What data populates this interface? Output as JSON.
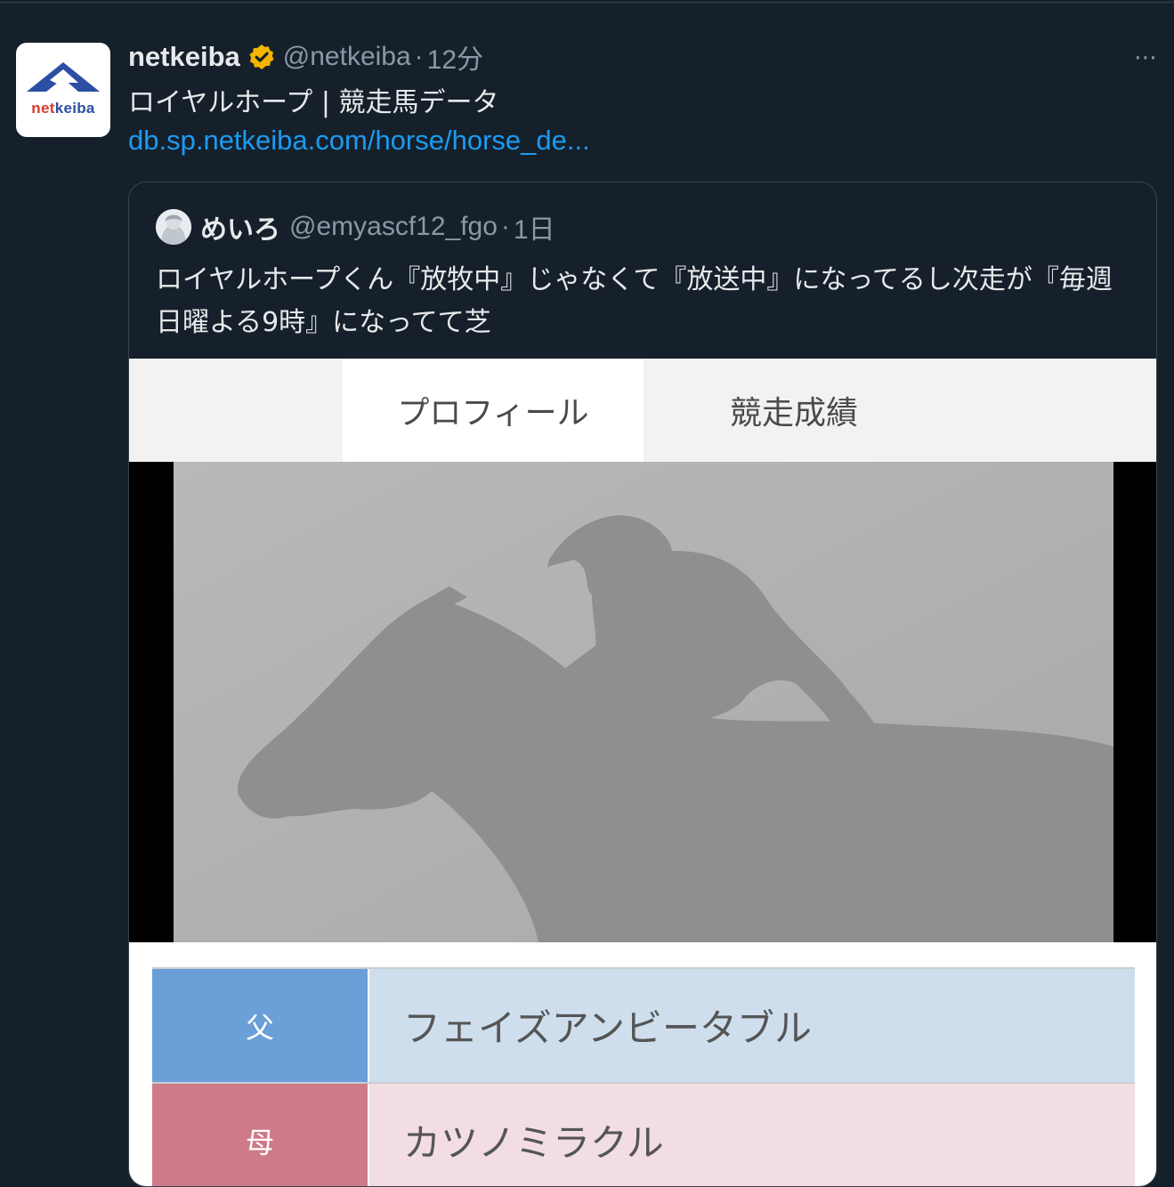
{
  "tweet": {
    "author": {
      "display_name": "netkeiba",
      "handle": "@netkeiba",
      "verified": true,
      "avatar_logo_prefix": "net",
      "avatar_logo_suffix": "keiba"
    },
    "separator": "·",
    "time": "12分",
    "more_icon": "⋯",
    "text": "ロイヤルホープ | 競走馬データ",
    "link_text": "db.sp.netkeiba.com/horse/horse_de..."
  },
  "quote": {
    "author": {
      "display_name": "めいろ",
      "handle": "@emyascf12_fgo"
    },
    "separator": "·",
    "time": "1日",
    "text": "ロイヤルホープくん『放牧中』じゃなくて『放送中』になってるし次走が『毎週日曜よる9時』になってて芝",
    "image": {
      "tabs": [
        "プロフィール",
        "競走成績"
      ],
      "pedigree": [
        {
          "label": "父",
          "value": "フェイズアンビータブル"
        },
        {
          "label": "母",
          "value": "カツノミラクル"
        }
      ]
    }
  },
  "colors": {
    "background": "#15202b",
    "link": "#1d9bf0",
    "verified": "#f4b400",
    "muted": "#8b98a5",
    "sire_label": "#6a9fd8",
    "dam_label": "#cf7a88"
  }
}
